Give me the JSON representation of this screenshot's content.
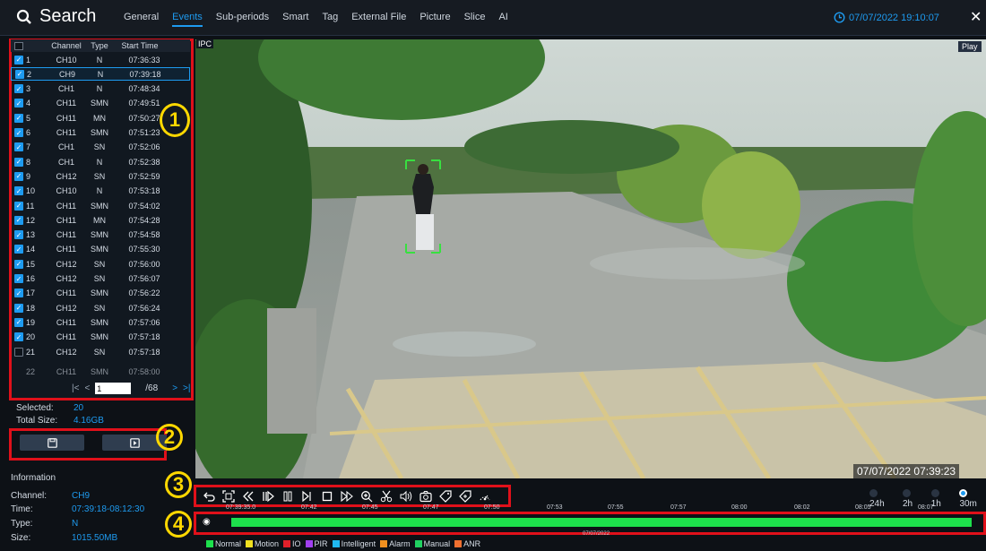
{
  "header": {
    "title": "Search",
    "tabs": [
      "General",
      "Events",
      "Sub-periods",
      "Smart",
      "Tag",
      "External File",
      "Picture",
      "Slice",
      "AI"
    ],
    "active_tab": "Events",
    "datetime": "07/07/2022 19:10:07"
  },
  "list": {
    "columns": [
      "Channel",
      "Type",
      "Start Time"
    ],
    "rows": [
      {
        "n": "1",
        "ch": "CH10",
        "type": "N",
        "time": "07:36:33",
        "checked": true
      },
      {
        "n": "2",
        "ch": "CH9",
        "type": "N",
        "time": "07:39:18",
        "checked": true
      },
      {
        "n": "3",
        "ch": "CH1",
        "type": "N",
        "time": "07:48:34",
        "checked": true
      },
      {
        "n": "4",
        "ch": "CH11",
        "type": "SMN",
        "time": "07:49:51",
        "checked": true
      },
      {
        "n": "5",
        "ch": "CH11",
        "type": "MN",
        "time": "07:50:27",
        "checked": true
      },
      {
        "n": "6",
        "ch": "CH11",
        "type": "SMN",
        "time": "07:51:23",
        "checked": true
      },
      {
        "n": "7",
        "ch": "CH1",
        "type": "SN",
        "time": "07:52:06",
        "checked": true
      },
      {
        "n": "8",
        "ch": "CH1",
        "type": "N",
        "time": "07:52:38",
        "checked": true
      },
      {
        "n": "9",
        "ch": "CH12",
        "type": "SN",
        "time": "07:52:59",
        "checked": true
      },
      {
        "n": "10",
        "ch": "CH10",
        "type": "N",
        "time": "07:53:18",
        "checked": true
      },
      {
        "n": "11",
        "ch": "CH11",
        "type": "SMN",
        "time": "07:54:02",
        "checked": true
      },
      {
        "n": "12",
        "ch": "CH11",
        "type": "MN",
        "time": "07:54:28",
        "checked": true
      },
      {
        "n": "13",
        "ch": "CH11",
        "type": "SMN",
        "time": "07:54:58",
        "checked": true
      },
      {
        "n": "14",
        "ch": "CH11",
        "type": "SMN",
        "time": "07:55:30",
        "checked": true
      },
      {
        "n": "15",
        "ch": "CH12",
        "type": "SN",
        "time": "07:56:00",
        "checked": true
      },
      {
        "n": "16",
        "ch": "CH12",
        "type": "SN",
        "time": "07:56:07",
        "checked": true
      },
      {
        "n": "17",
        "ch": "CH11",
        "type": "SMN",
        "time": "07:56:22",
        "checked": true
      },
      {
        "n": "18",
        "ch": "CH12",
        "type": "SN",
        "time": "07:56:24",
        "checked": true
      },
      {
        "n": "19",
        "ch": "CH11",
        "type": "SMN",
        "time": "07:57:06",
        "checked": true
      },
      {
        "n": "20",
        "ch": "CH11",
        "type": "SMN",
        "time": "07:57:18",
        "checked": true
      },
      {
        "n": "21",
        "ch": "CH12",
        "type": "SN",
        "time": "07:57:18",
        "checked": false
      }
    ],
    "selected_row": "2",
    "page_current": "1",
    "page_total": "/68"
  },
  "summary": {
    "selected_label": "Selected:",
    "selected_value": "20",
    "size_label": "Total Size:",
    "size_value": "4.16GB"
  },
  "information": {
    "heading": "Information",
    "channel_label": "Channel:",
    "channel_value": "CH9",
    "time_label": "Time:",
    "time_value": "07:39:18-08:12:30",
    "type_label": "Type:",
    "type_value": "N",
    "size_label": "Size:",
    "size_value": "1015.50MB"
  },
  "video": {
    "channel_tag": "IPC",
    "status": "Play",
    "timestamp": "07/07/2022 07:39:23"
  },
  "playback": {
    "spans": [
      "24h",
      "2h",
      "1h",
      "30m"
    ],
    "active_span": "30m",
    "ticks": [
      "07:39:35.0",
      "07:42",
      "07:45",
      "07:47",
      "07:50",
      "07:53",
      "07:55",
      "07:57",
      "08:00",
      "08:02",
      "08:05",
      "08:07"
    ],
    "date": "07/07/2022",
    "bar_color": "#1de04c"
  },
  "legend": [
    {
      "label": "Normal",
      "color": "#1de04c"
    },
    {
      "label": "Motion",
      "color": "#f0e020"
    },
    {
      "label": "IO",
      "color": "#e0202a"
    },
    {
      "label": "PIR",
      "color": "#a040f0"
    },
    {
      "label": "Intelligent",
      "color": "#20b8f0"
    },
    {
      "label": "Alarm",
      "color": "#f09020"
    },
    {
      "label": "Manual",
      "color": "#20d060"
    },
    {
      "label": "ANR",
      "color": "#f07030"
    }
  ],
  "callouts": [
    "1",
    "2",
    "3",
    "4"
  ]
}
